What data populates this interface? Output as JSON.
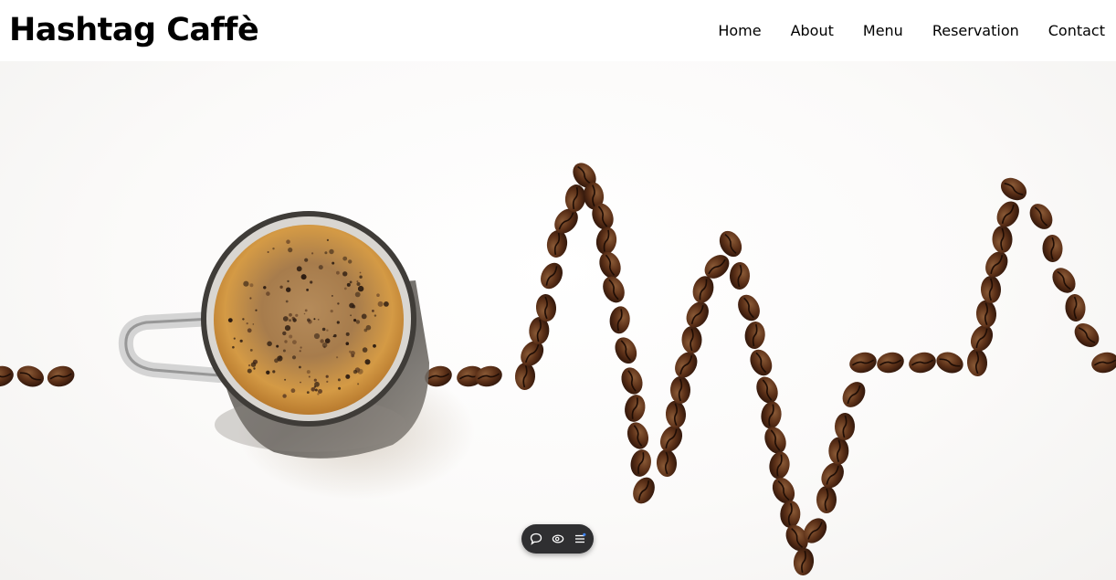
{
  "header": {
    "brand": "Hashtag Caffè",
    "nav": [
      {
        "label": "Home"
      },
      {
        "label": "About"
      },
      {
        "label": "Menu"
      },
      {
        "label": "Reservation"
      },
      {
        "label": "Contact"
      }
    ]
  },
  "hero": {
    "image": "coffee-cup-with-heartbeat-coffee-beans"
  },
  "widget": {
    "icons": [
      "comment-icon",
      "eye-icon",
      "menu-icon"
    ],
    "accent": "#3b82f6"
  },
  "colors": {
    "nav_bg": "#ffffff",
    "bean": "#4a2412",
    "coffee_crema": "#c98a3c",
    "widget_bg": "#2f2f31"
  }
}
